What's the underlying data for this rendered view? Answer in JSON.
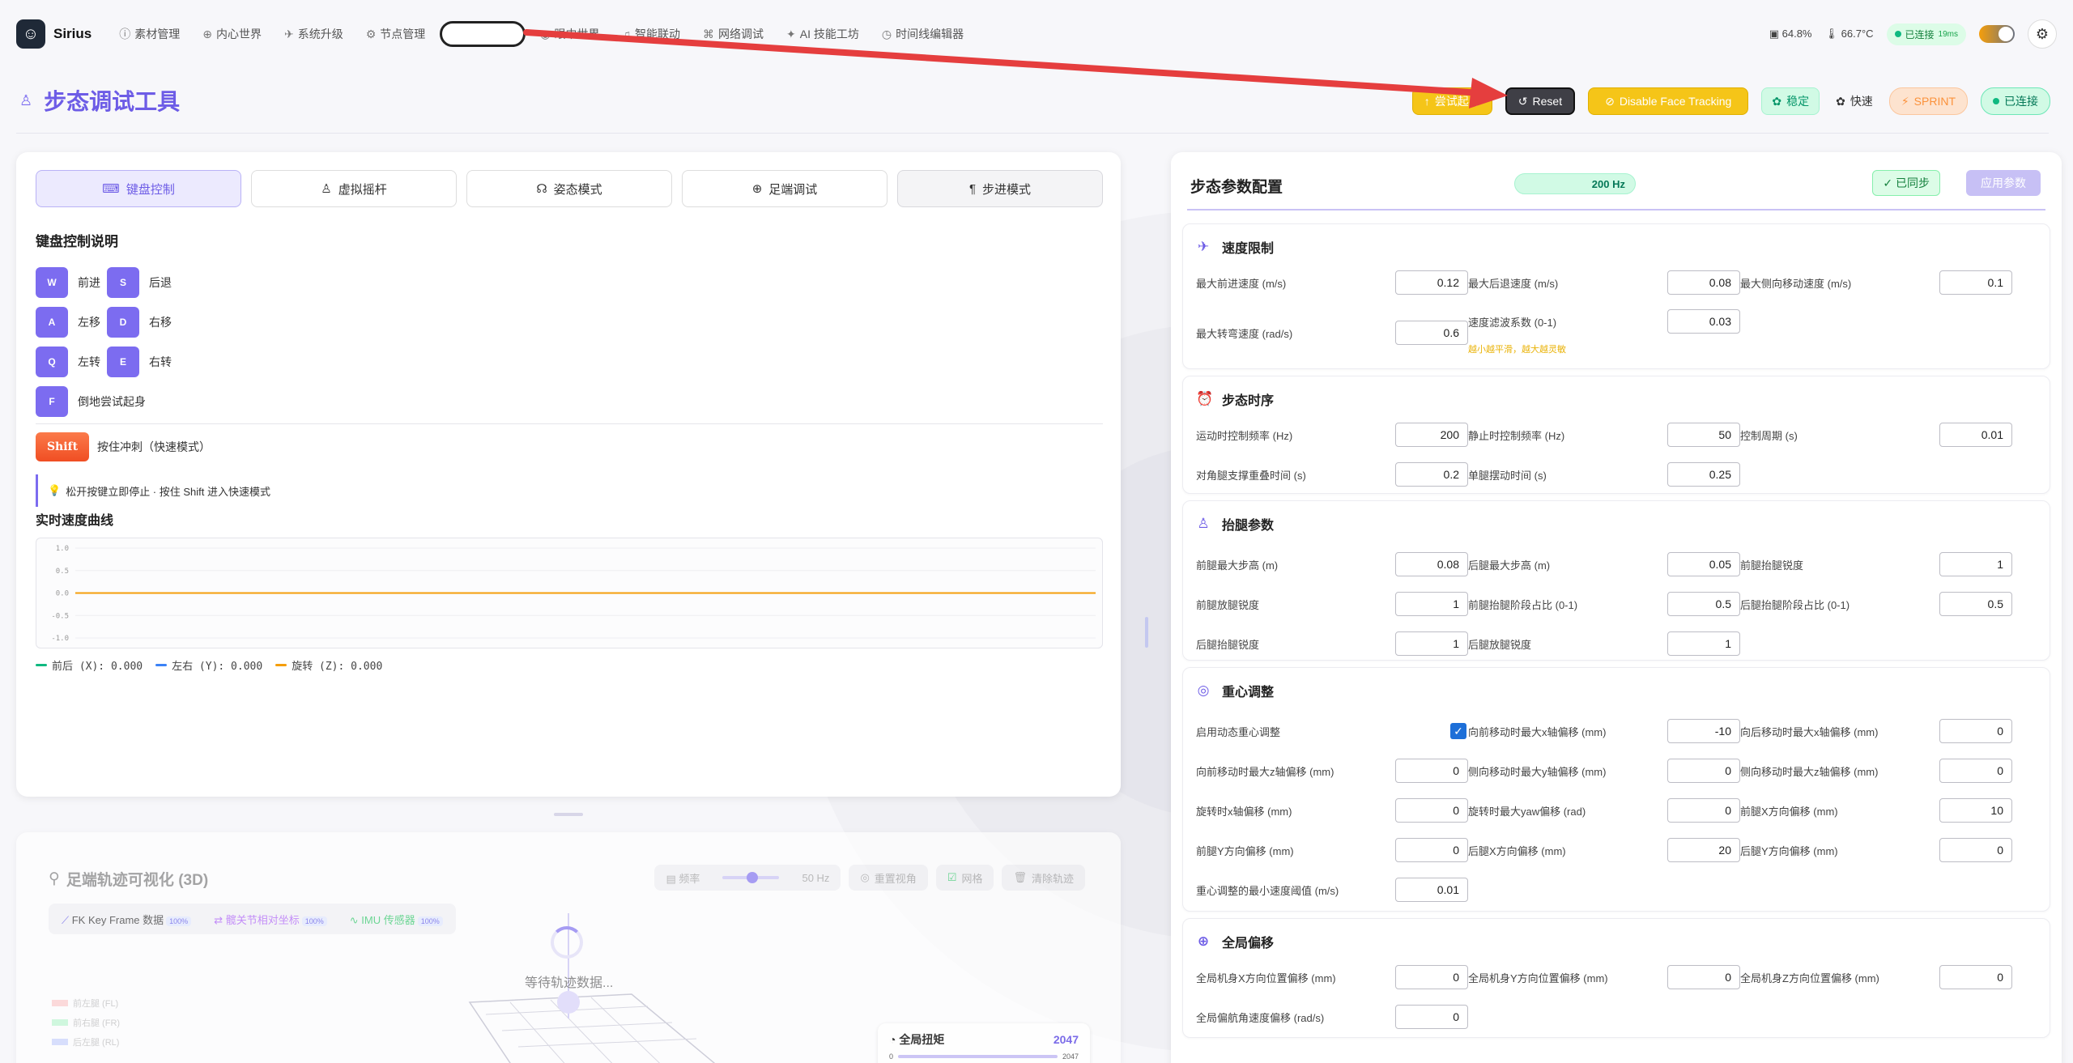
{
  "app": {
    "name": "Sirius"
  },
  "nav": [
    {
      "icon": "help-circle-icon",
      "label": "素材管理"
    },
    {
      "icon": "globe-icon",
      "label": "内心世界"
    },
    {
      "icon": "rocket-icon",
      "label": "系统升级"
    },
    {
      "icon": "gear-icon",
      "label": "节点管理"
    },
    {
      "icon": "",
      "label": ""
    },
    {
      "icon": "eye-icon",
      "label": "眼中世界"
    },
    {
      "icon": "music-icon",
      "label": "智能联动"
    },
    {
      "icon": "network-icon",
      "label": "网络调试"
    },
    {
      "icon": "sparkle-icon",
      "label": "AI 技能工坊"
    },
    {
      "icon": "clock-icon",
      "label": "时间线编辑器"
    }
  ],
  "status": {
    "cpu": "64.8%",
    "temp": "66.7°C",
    "connection": "已连接",
    "latency": "19ms"
  },
  "page": {
    "title": "步态调试工具"
  },
  "header_buttons": {
    "try_getup": "尝试起身",
    "reset": "Reset",
    "face_tracking": "Disable Face Tracking",
    "stable": "稳定",
    "fast": "快速",
    "sprint": "SPRINT",
    "connected": "已连接"
  },
  "mode_tabs": [
    {
      "icon": "keyboard-icon",
      "label": "键盘控制"
    },
    {
      "icon": "joystick-icon",
      "label": "虚拟摇杆"
    },
    {
      "icon": "posture-icon",
      "label": "姿态模式"
    },
    {
      "icon": "globe-icon",
      "label": "足端调试"
    },
    {
      "icon": "pilcrow-icon",
      "label": "步进模式"
    }
  ],
  "keyboard": {
    "title": "键盘控制说明",
    "keys": [
      [
        {
          "key": "W",
          "label": "前进"
        },
        {
          "key": "S",
          "label": "后退"
        }
      ],
      [
        {
          "key": "A",
          "label": "左移"
        },
        {
          "key": "D",
          "label": "右移"
        }
      ],
      [
        {
          "key": "Q",
          "label": "左转"
        },
        {
          "key": "E",
          "label": "右转"
        }
      ],
      [
        {
          "key": "F",
          "label": "倒地尝试起身"
        }
      ]
    ],
    "shift_key": "Shift",
    "shift_label": "按住冲刺（快速模式）",
    "tip": "松开按键立即停止 · 按住 Shift 进入快速模式"
  },
  "speed_chart": {
    "title": "实时速度曲线",
    "legend": [
      "前后 (X): 0.000",
      "左右 (Y): 0.000",
      "旋转 (Z): 0.000"
    ]
  },
  "chart_data": {
    "type": "line",
    "title": "实时速度曲线",
    "yticks": [
      "1.0",
      "0.5",
      "0.0",
      "-0.5",
      "-1.0"
    ],
    "ylim": [
      -1,
      1
    ],
    "series": [
      {
        "name": "前后 (X)",
        "color": "#10b981",
        "values": [
          0,
          0
        ]
      },
      {
        "name": "左右 (Y)",
        "color": "#3b82f6",
        "values": [
          0,
          0
        ]
      },
      {
        "name": "旋转 (Z)",
        "color": "#f59e0b",
        "values": [
          0,
          0
        ]
      }
    ]
  },
  "viz": {
    "title": "足端轨迹可视化 (3D)",
    "freq_label": "频率",
    "freq_value": "50 Hz",
    "reset_view": "重置视角",
    "grid": "网格",
    "clear": "清除轨迹",
    "sources": [
      {
        "label": "FK Key Frame 数据",
        "badge": "100%"
      },
      {
        "label": "髋关节相对坐标",
        "badge": "100%"
      },
      {
        "label": "IMU 传感器",
        "badge": "100%"
      }
    ],
    "waiting": "等待轨迹数据...",
    "legend": [
      "前左腿 (FL)",
      "前右腿 (FR)",
      "后左腿 (RL)"
    ],
    "torque_title": "全局扭矩",
    "torque_value": "2047",
    "torque_min": "0",
    "torque_max": "2047"
  },
  "params": {
    "title": "步态参数配置",
    "rate": "200 Hz",
    "synced": "✓ 已同步",
    "apply": "应用参数",
    "groups": {
      "speed": {
        "title": "速度限制",
        "fields": [
          {
            "label": "最大前进速度 (m/s)",
            "value": "0.12"
          },
          {
            "label": "最大后退速度 (m/s)",
            "value": "0.08"
          },
          {
            "label": "最大侧向移动速度 (m/s)",
            "value": "0.1"
          },
          {
            "label": "最大转弯速度 (rad/s)",
            "value": "0.6"
          },
          {
            "label": "速度滤波系数 (0-1)",
            "value": "0.03"
          }
        ],
        "hint": "越小越平滑，越大越灵敏"
      },
      "timing": {
        "title": "步态时序",
        "fields": [
          {
            "label": "运动时控制频率 (Hz)",
            "value": "200"
          },
          {
            "label": "静止时控制频率 (Hz)",
            "value": "50"
          },
          {
            "label": "控制周期 (s)",
            "value": "0.01"
          },
          {
            "label": "对角腿支撑重叠时间 (s)",
            "value": "0.2"
          },
          {
            "label": "单腿摆动时间 (s)",
            "value": "0.25"
          }
        ]
      },
      "lift": {
        "title": "抬腿参数",
        "fields": [
          {
            "label": "前腿最大步高 (m)",
            "value": "0.08"
          },
          {
            "label": "后腿最大步高 (m)",
            "value": "0.05"
          },
          {
            "label": "前腿抬腿锐度",
            "value": "1"
          },
          {
            "label": "前腿放腿锐度",
            "value": "1"
          },
          {
            "label": "前腿抬腿阶段占比 (0-1)",
            "value": "0.5"
          },
          {
            "label": "后腿抬腿阶段占比 (0-1)",
            "value": "0.5"
          },
          {
            "label": "后腿抬腿锐度",
            "value": "1"
          },
          {
            "label": "后腿放腿锐度",
            "value": "1"
          }
        ]
      },
      "cog": {
        "title": "重心调整",
        "enable_label": "启用动态重心调整",
        "fields": [
          {
            "label": "向前移动时最大x轴偏移 (mm)",
            "value": "-10"
          },
          {
            "label": "向后移动时最大x轴偏移 (mm)",
            "value": "0"
          },
          {
            "label": "向前移动时最大z轴偏移 (mm)",
            "value": "0"
          },
          {
            "label": "侧向移动时最大y轴偏移 (mm)",
            "value": "0"
          },
          {
            "label": "侧向移动时最大z轴偏移 (mm)",
            "value": "0"
          },
          {
            "label": "旋转时x轴偏移 (mm)",
            "value": "0"
          },
          {
            "label": "旋转时最大yaw偏移 (rad)",
            "value": "0"
          },
          {
            "label": "前腿X方向偏移 (mm)",
            "value": "10"
          },
          {
            "label": "前腿Y方向偏移 (mm)",
            "value": "0"
          },
          {
            "label": "后腿X方向偏移 (mm)",
            "value": "20"
          },
          {
            "label": "后腿Y方向偏移 (mm)",
            "value": "0"
          },
          {
            "label": "重心调整的最小速度阈值 (m/s)",
            "value": "0.01"
          }
        ]
      },
      "global": {
        "title": "全局偏移",
        "fields": [
          {
            "label": "全局机身X方向位置偏移 (mm)",
            "value": "0"
          },
          {
            "label": "全局机身Y方向位置偏移 (mm)",
            "value": "0"
          },
          {
            "label": "全局机身Z方向位置偏移 (mm)",
            "value": "0"
          },
          {
            "label": "全局偏航角速度偏移 (rad/s)",
            "value": "0"
          }
        ]
      }
    }
  },
  "colors": {
    "accent": "#6d5ce6",
    "warning": "#f5c518",
    "success": "#10b981",
    "annotation": "#e53e3e"
  }
}
